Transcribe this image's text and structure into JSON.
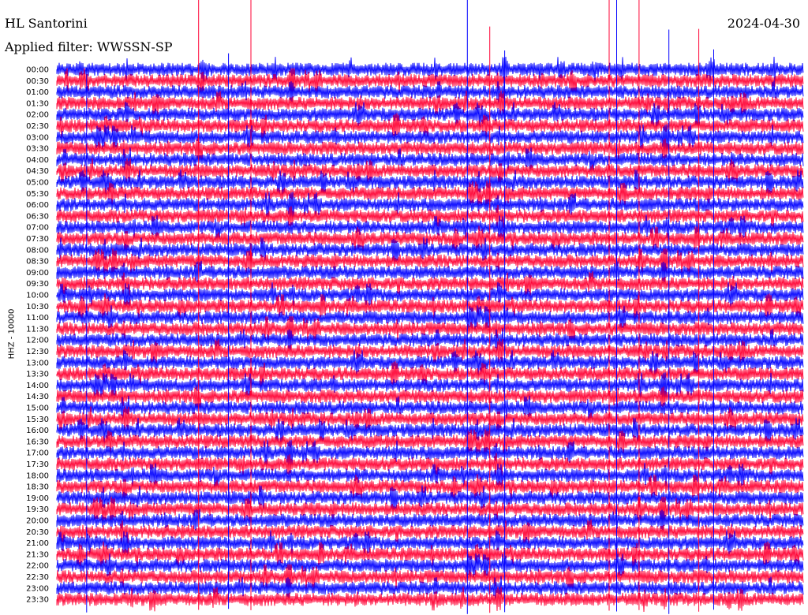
{
  "header": {
    "station": "HL Santorini",
    "filter": "Applied filter: WWSSN-SP",
    "date": "2024-04-30"
  },
  "colors": {
    "trace_a": "#0000ff",
    "trace_b": "#ff0033",
    "background": "#ffffff"
  },
  "chart_data": {
    "type": "line",
    "subtype": "helicorder",
    "title": "",
    "xlabel": "",
    "ylabel": "HHZ - 10000",
    "row_labels": [
      "00:00",
      "00:30",
      "01:00",
      "01:30",
      "02:00",
      "02:30",
      "03:00",
      "03:30",
      "04:00",
      "04:30",
      "05:00",
      "05:30",
      "06:00",
      "06:30",
      "07:00",
      "07:30",
      "08:00",
      "08:30",
      "09:00",
      "09:30",
      "10:00",
      "10:30",
      "11:00",
      "11:30",
      "12:00",
      "12:30",
      "13:00",
      "13:30",
      "14:00",
      "14:30",
      "15:00",
      "15:30",
      "16:00",
      "16:30",
      "17:00",
      "17:30",
      "18:00",
      "18:30",
      "19:00",
      "19:30",
      "20:00",
      "20:30",
      "21:00",
      "21:30",
      "22:00",
      "22:30",
      "23:00",
      "23:30"
    ],
    "row_minutes": 30,
    "series_colors_alternate": [
      "#0000ff",
      "#ff0033"
    ],
    "grid": false,
    "legend": "none",
    "notable_spikes_x_fraction": [
      0.04,
      0.19,
      0.23,
      0.26,
      0.55,
      0.58,
      0.6,
      0.74,
      0.75,
      0.78,
      0.82,
      0.86,
      0.88
    ]
  }
}
